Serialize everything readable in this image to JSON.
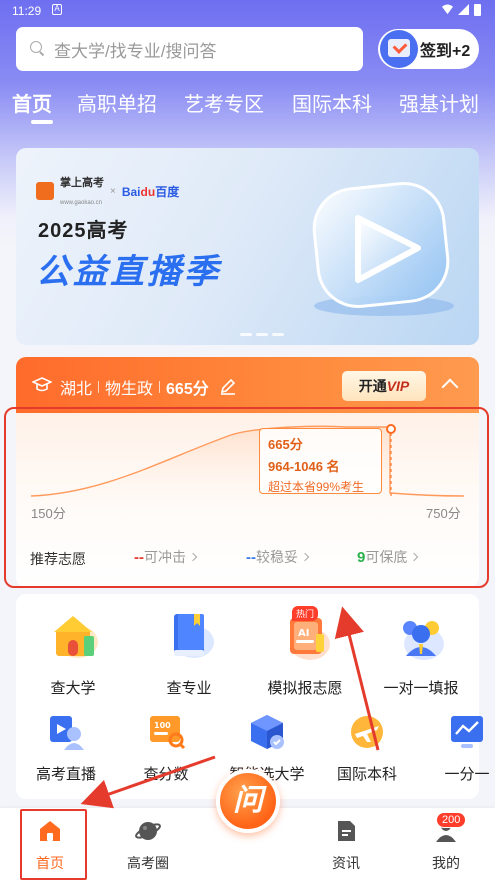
{
  "status_bar": {
    "time": "11:29",
    "app_indicator": "A"
  },
  "search": {
    "placeholder": "查大学/找专业/搜问答"
  },
  "checkin": {
    "label": "签到+2"
  },
  "tabs": [
    {
      "label": "首页",
      "active": true
    },
    {
      "label": "高职单招"
    },
    {
      "label": "艺考专区"
    },
    {
      "label": "国际本科"
    },
    {
      "label": "强基计划"
    }
  ],
  "banner": {
    "brand1": "掌上高考",
    "brand1_sub": "www.gaokao.cn",
    "brand_sep": "×",
    "brand2": "Bai",
    "brand2_b": "du",
    "brand2_c": "百度",
    "year": "2025高考",
    "title": "公益直播季"
  },
  "profile": {
    "province": "湖北",
    "subjects": "物生政",
    "score": "665分",
    "vip_label": "开通",
    "vip_accent": "VIP"
  },
  "rank": {
    "score": "665分",
    "range": "964-1046 名",
    "percentile": "超过本省99%考生",
    "axis_min": "150分",
    "axis_max": "750分"
  },
  "recommend": {
    "title": "推荐志愿",
    "reach_value": "--",
    "reach_label": "可冲击",
    "stable_value": "--",
    "stable_label": "较稳妥",
    "safe_value": "9",
    "safe_label": "可保底"
  },
  "grid_row1": [
    {
      "label": "查大学",
      "icon": "university-icon"
    },
    {
      "label": "查专业",
      "icon": "book-icon"
    },
    {
      "label": "模拟报志愿",
      "icon": "ai-form-icon"
    },
    {
      "label": "一对一填报",
      "icon": "consultant-icon"
    }
  ],
  "hot_tag": "热门",
  "grid_row2": [
    {
      "label": "高考直播",
      "icon": "live-icon"
    },
    {
      "label": "查分数",
      "icon": "score-icon"
    },
    {
      "label": "智能选大学",
      "icon": "cube-icon"
    },
    {
      "label": "国际本科",
      "icon": "plane-icon"
    },
    {
      "label": "一分一",
      "icon": "chart-icon"
    }
  ],
  "bottom_nav": [
    {
      "label": "首页",
      "active": true
    },
    {
      "label": "高考圈"
    },
    {
      "label": "资讯"
    },
    {
      "label": "我的"
    }
  ],
  "ask_glyph": "问",
  "message_badge": "200",
  "colors": {
    "accent": "#ff6a1f",
    "brand_blue": "#2a6ff0",
    "annotation": "#e53b2c"
  }
}
